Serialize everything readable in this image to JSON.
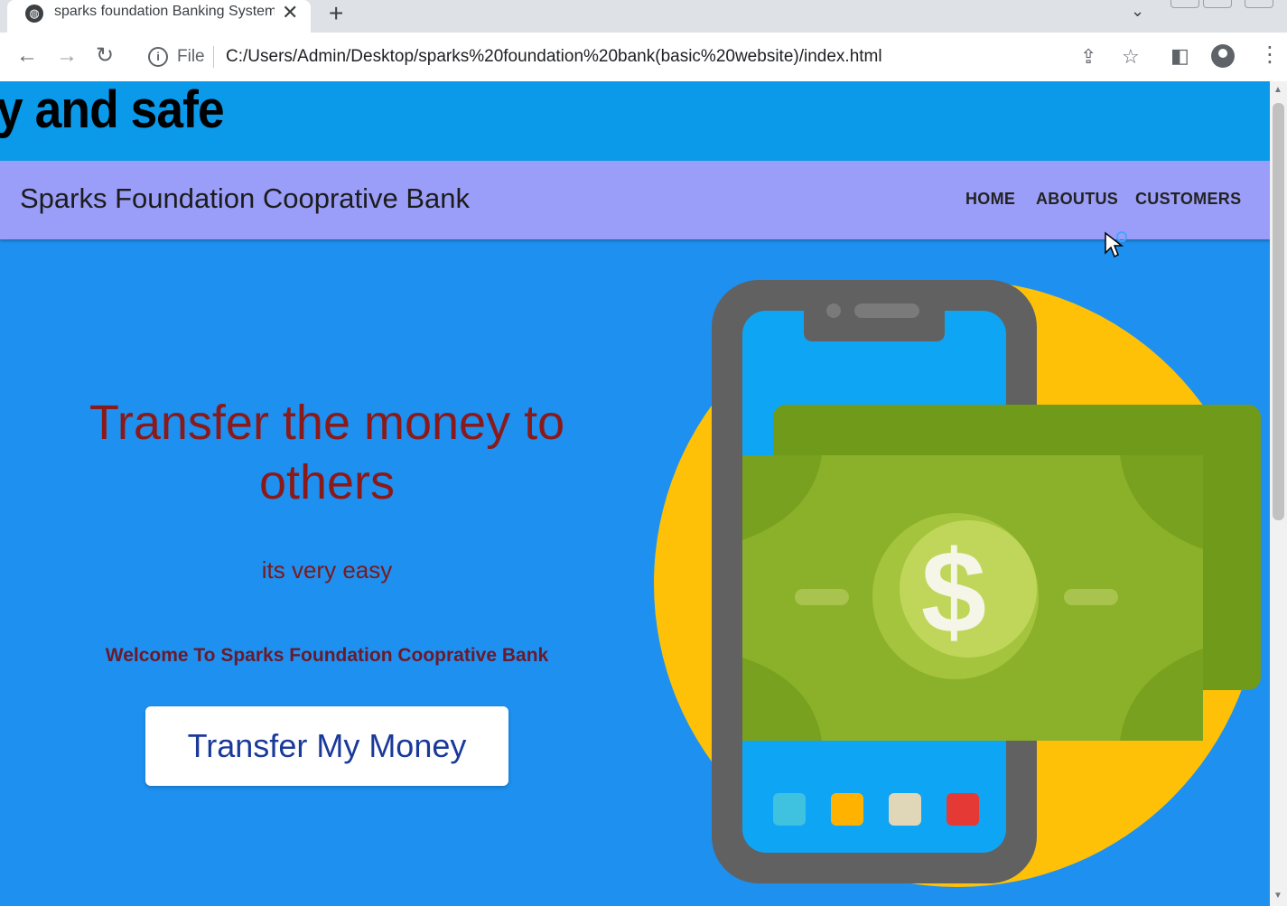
{
  "browser": {
    "tab_title": "sparks foundation Banking System",
    "tab_close": "✕",
    "new_tab": "+",
    "tab_menu": "⌄",
    "scheme_label": "File",
    "url": "C:/Users/Admin/Desktop/sparks%20foundation%20bank(basic%20website)/index.html",
    "icons": [
      "back-icon",
      "forward-icon",
      "reload-icon",
      "info-icon",
      "share-icon",
      "star-icon",
      "side-panel-icon",
      "profile-icon",
      "menu-icon"
    ]
  },
  "page": {
    "marquee_text": "y and safe",
    "brand": "Sparks Foundation Cooprative Bank",
    "nav": [
      "HOME",
      "ABOUTUS",
      "CUSTOMERS"
    ],
    "hero": {
      "headline": "Transfer the money to others",
      "subtitle": "its very easy",
      "welcome": "Welcome To Sparks Foundation Cooprative Bank",
      "button_label": "Transfer My Money"
    },
    "illustration_symbol": "$"
  },
  "colors": {
    "page_bg": "#1e90f0",
    "marquee_bg": "#0b9aea",
    "navbar_bg": "#9b9ef8",
    "headline": "#8a1a1a",
    "button_text": "#1a3a9a",
    "circle": "#ffc107",
    "money_green": "#8bb12a"
  }
}
